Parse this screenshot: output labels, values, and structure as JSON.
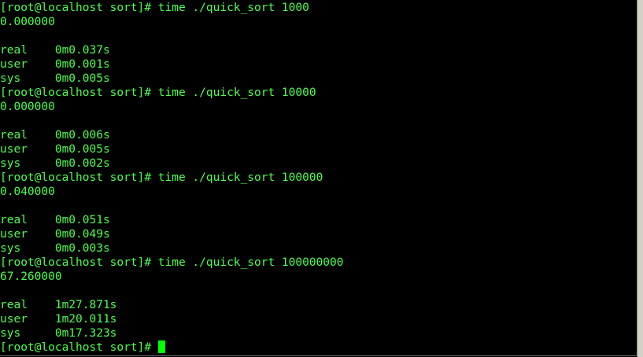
{
  "terminal": {
    "lines": [
      "[root@localhost sort]# time ./quick_sort 1000",
      "0.000000",
      "",
      "real    0m0.037s",
      "user    0m0.001s",
      "sys     0m0.005s",
      "[root@localhost sort]# time ./quick_sort 10000",
      "0.000000",
      "",
      "real    0m0.006s",
      "user    0m0.005s",
      "sys     0m0.002s",
      "[root@localhost sort]# time ./quick_sort 100000",
      "0.040000",
      "",
      "real    0m0.051s",
      "user    0m0.049s",
      "sys     0m0.003s",
      "[root@localhost sort]# time ./quick_sort 100000000",
      "67.260000",
      "",
      "real    1m27.871s",
      "user    1m20.011s",
      "sys     0m17.323s"
    ],
    "prompt": "[root@localhost sort]# "
  },
  "colors": {
    "background": "#000000",
    "text": "#4cff4c",
    "cursor": "#00ff00"
  }
}
